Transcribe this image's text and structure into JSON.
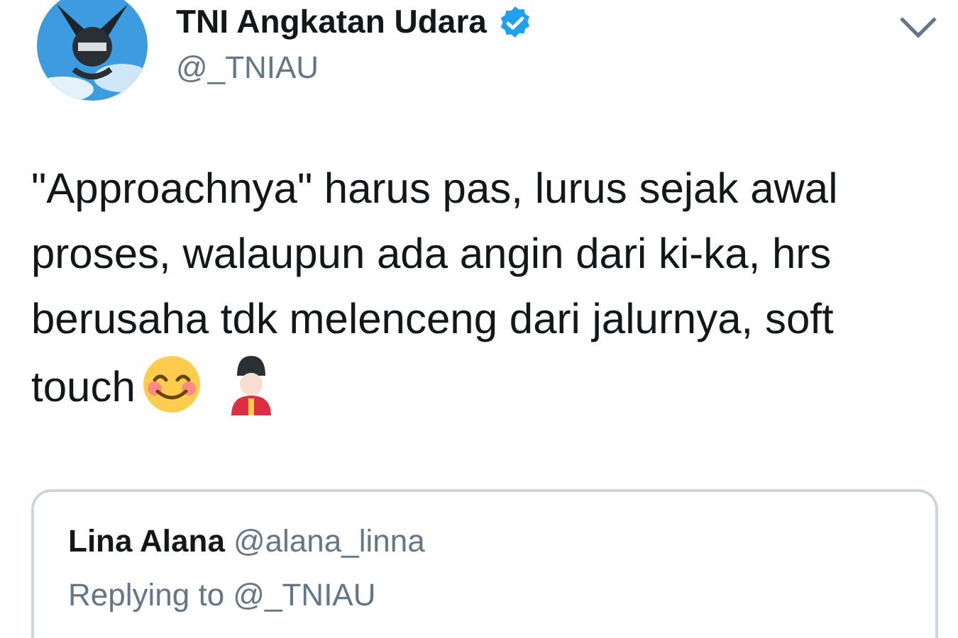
{
  "tweet": {
    "author": {
      "name": "TNI Angkatan Udara",
      "verified": true,
      "handle": "@_TNIAU"
    },
    "text": "\"Approachnya\" harus pas, lurus sejak awal proses, walaupun ada angin dari ki-ka, hrs berusaha tdk melenceng dari jalurnya, soft touch",
    "quoted": {
      "name": "Lina Alana",
      "handle": "@alana_linna",
      "reply_to": "Replying to @_TNIAU"
    }
  }
}
